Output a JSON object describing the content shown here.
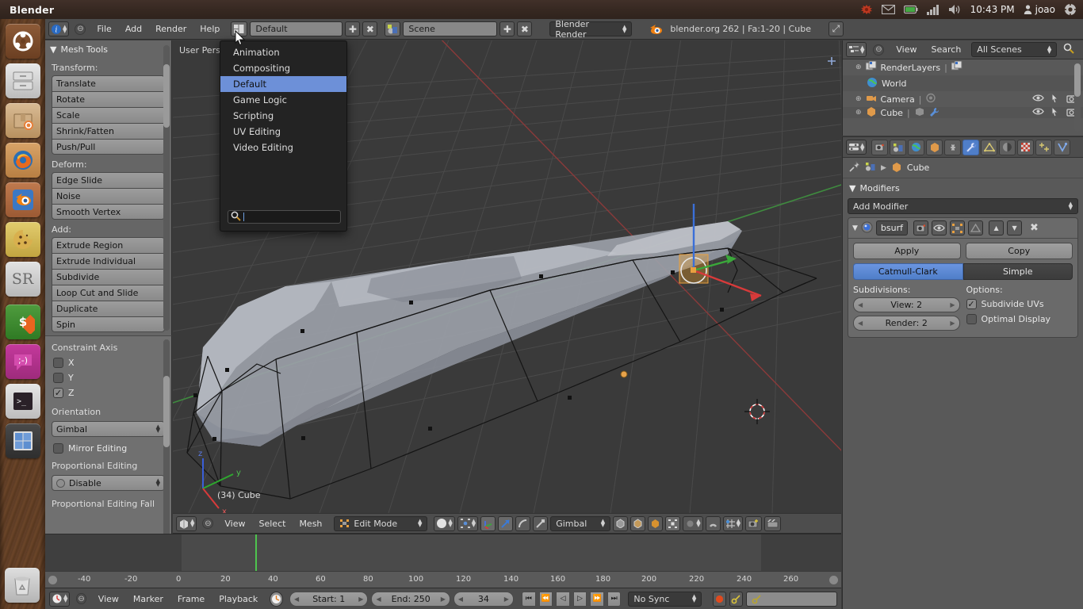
{
  "os_panel": {
    "app_title": "Blender",
    "clock": "10:43 PM",
    "user": "joao",
    "indicators": [
      "bug-icon",
      "mail-icon",
      "battery-icon",
      "network-icon",
      "volume-icon",
      "gear-icon"
    ]
  },
  "launcher": {
    "items": [
      {
        "name": "ubuntu-dash-icon",
        "label": "Ubuntu Dash"
      },
      {
        "name": "files-icon",
        "label": "Files"
      },
      {
        "name": "software-center-icon",
        "label": "Ubuntu Software Center"
      },
      {
        "name": "firefox-icon",
        "label": "Firefox"
      },
      {
        "name": "blender-icon",
        "label": "Blender"
      },
      {
        "name": "cookie-icon",
        "label": "Cookie"
      },
      {
        "name": "sr-icon",
        "label": "SR"
      },
      {
        "name": "money-icon",
        "label": "Money"
      },
      {
        "name": "chat-icon",
        "label": "Chat"
      },
      {
        "name": "terminal-icon",
        "label": "Terminal"
      },
      {
        "name": "workspace-switcher-icon",
        "label": "Workspace Switcher"
      },
      {
        "name": "trash-icon",
        "label": "Trash"
      }
    ]
  },
  "blender_header": {
    "menus": [
      "File",
      "Add",
      "Render",
      "Help"
    ],
    "screen_layout": "Default",
    "scene_name": "Scene",
    "render_engine": "Blender Render",
    "status": "blender.org 262 | Fa:1-20 | Cube"
  },
  "screen_menu": {
    "items": [
      "Animation",
      "Compositing",
      "Default",
      "Game Logic",
      "Scripting",
      "UV Editing",
      "Video Editing"
    ],
    "selected": "Default",
    "search_value": ""
  },
  "toolshelf": {
    "panel_title": "Mesh Tools",
    "sections": [
      {
        "label": "Transform:",
        "buttons": [
          "Translate",
          "Rotate",
          "Scale",
          "Shrink/Fatten",
          "Push/Pull"
        ]
      },
      {
        "label": "Deform:",
        "buttons": [
          "Edge Slide",
          "Noise",
          "Smooth Vertex"
        ]
      },
      {
        "label": "Add:",
        "buttons": [
          "Extrude Region",
          "Extrude Individual",
          "Subdivide",
          "Loop Cut and Slide",
          "Duplicate",
          "Spin"
        ]
      }
    ]
  },
  "operator_panel": {
    "constraint_axis_label": "Constraint Axis",
    "axes": [
      {
        "label": "X",
        "checked": false
      },
      {
        "label": "Y",
        "checked": false
      },
      {
        "label": "Z",
        "checked": true
      }
    ],
    "orientation_label": "Orientation",
    "orientation_value": "Gimbal",
    "mirror_editing": {
      "label": "Mirror Editing",
      "checked": false
    },
    "prop_editing_label": "Proportional Editing",
    "prop_editing_value": "Disable",
    "prop_falloff_label": "Proportional Editing Fall"
  },
  "viewport": {
    "perspective": "User Persp",
    "object_info": "(34) Cube",
    "axis_gizmo": {
      "x": "x",
      "y": "y",
      "z": "z"
    },
    "header": {
      "menus": [
        "View",
        "Select",
        "Mesh"
      ],
      "mode": "Edit Mode",
      "orientation": "Gimbal"
    }
  },
  "timeline": {
    "ruler_ticks": [
      "-40",
      "-20",
      "0",
      "20",
      "40",
      "60",
      "80",
      "100",
      "120",
      "140",
      "160",
      "180",
      "200",
      "220",
      "240",
      "260"
    ],
    "menus": [
      "View",
      "Marker",
      "Frame",
      "Playback"
    ],
    "start": "Start: 1",
    "end": "End: 250",
    "current_frame": "34",
    "sync_mode": "No Sync"
  },
  "outliner": {
    "menus": [
      "View",
      "Search"
    ],
    "scope": "All Scenes",
    "rows": [
      {
        "label": "RenderLayers",
        "icon": "renderlayers-icon"
      },
      {
        "label": "World",
        "icon": "world-icon"
      },
      {
        "label": "Camera",
        "icon": "camera-icon"
      },
      {
        "label": "Cube",
        "icon": "mesh-icon"
      }
    ]
  },
  "properties": {
    "tabs": [
      "render-icon",
      "scene-icon",
      "world-icon",
      "object-icon",
      "constraints-icon",
      "wrench-icon",
      "data-icon",
      "material-icon",
      "texture-icon",
      "particles-icon",
      "physics-icon"
    ],
    "active_tab": "wrench-icon",
    "breadcrumb_object": "Cube",
    "panel_title": "Modifiers",
    "add_modifier": "Add Modifier",
    "modifier": {
      "name": "bsurf",
      "apply_label": "Apply",
      "copy_label": "Copy",
      "subdivision_type_selected": "Catmull-Clark",
      "subdivision_type_other": "Simple",
      "subdivisions_label": "Subdivisions:",
      "view_value": "View: 2",
      "render_value": "Render: 2",
      "options_label": "Options:",
      "options": [
        {
          "label": "Subdivide UVs",
          "checked": true
        },
        {
          "label": "Optimal Display",
          "checked": false
        }
      ]
    }
  },
  "colors": {
    "accent_blue": "#4f7ec8",
    "menu_highlight": "#6d90d8",
    "header_gray": "#4d4d4d",
    "panel_gray": "#666666",
    "viewport_bg": "#3a3a3a",
    "ubuntu_brown": "#5e3d26"
  }
}
